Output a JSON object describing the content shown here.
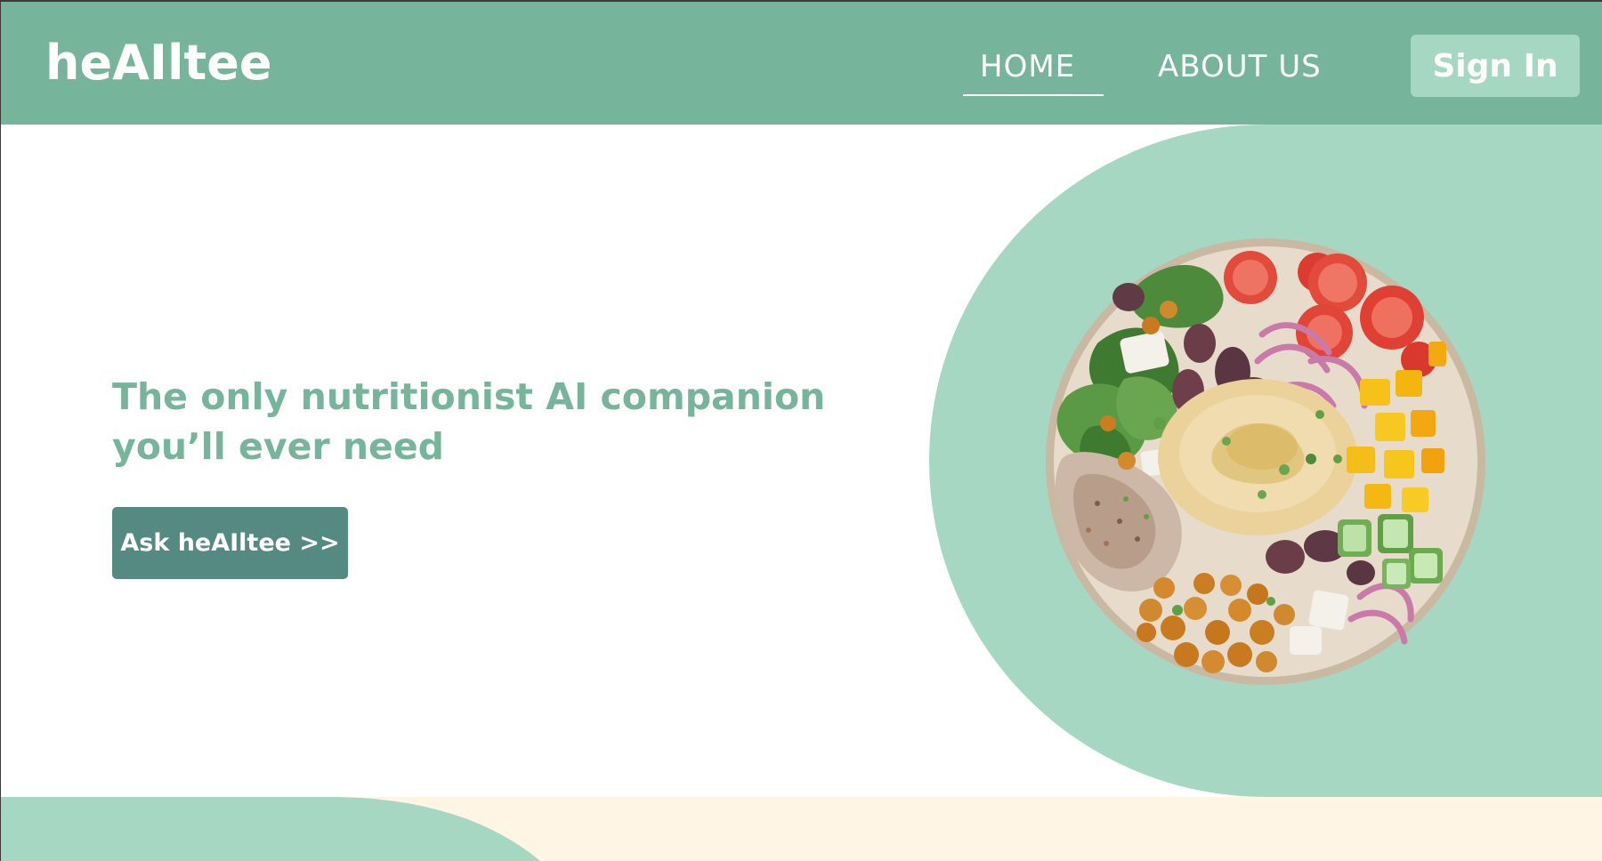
{
  "header": {
    "logo": "heAIltee",
    "nav": {
      "home": "HOME",
      "about": "ABOUT US"
    },
    "sign_in": "Sign In"
  },
  "hero": {
    "heading": "The only nutritionist AI companion you’ll ever need",
    "cta_label": "Ask heAIltee >>"
  },
  "colors": {
    "header_bg": "#76b49b",
    "accent_light": "#a6d7c3",
    "button_dark": "#558a82",
    "cream": "#fff5e4"
  }
}
